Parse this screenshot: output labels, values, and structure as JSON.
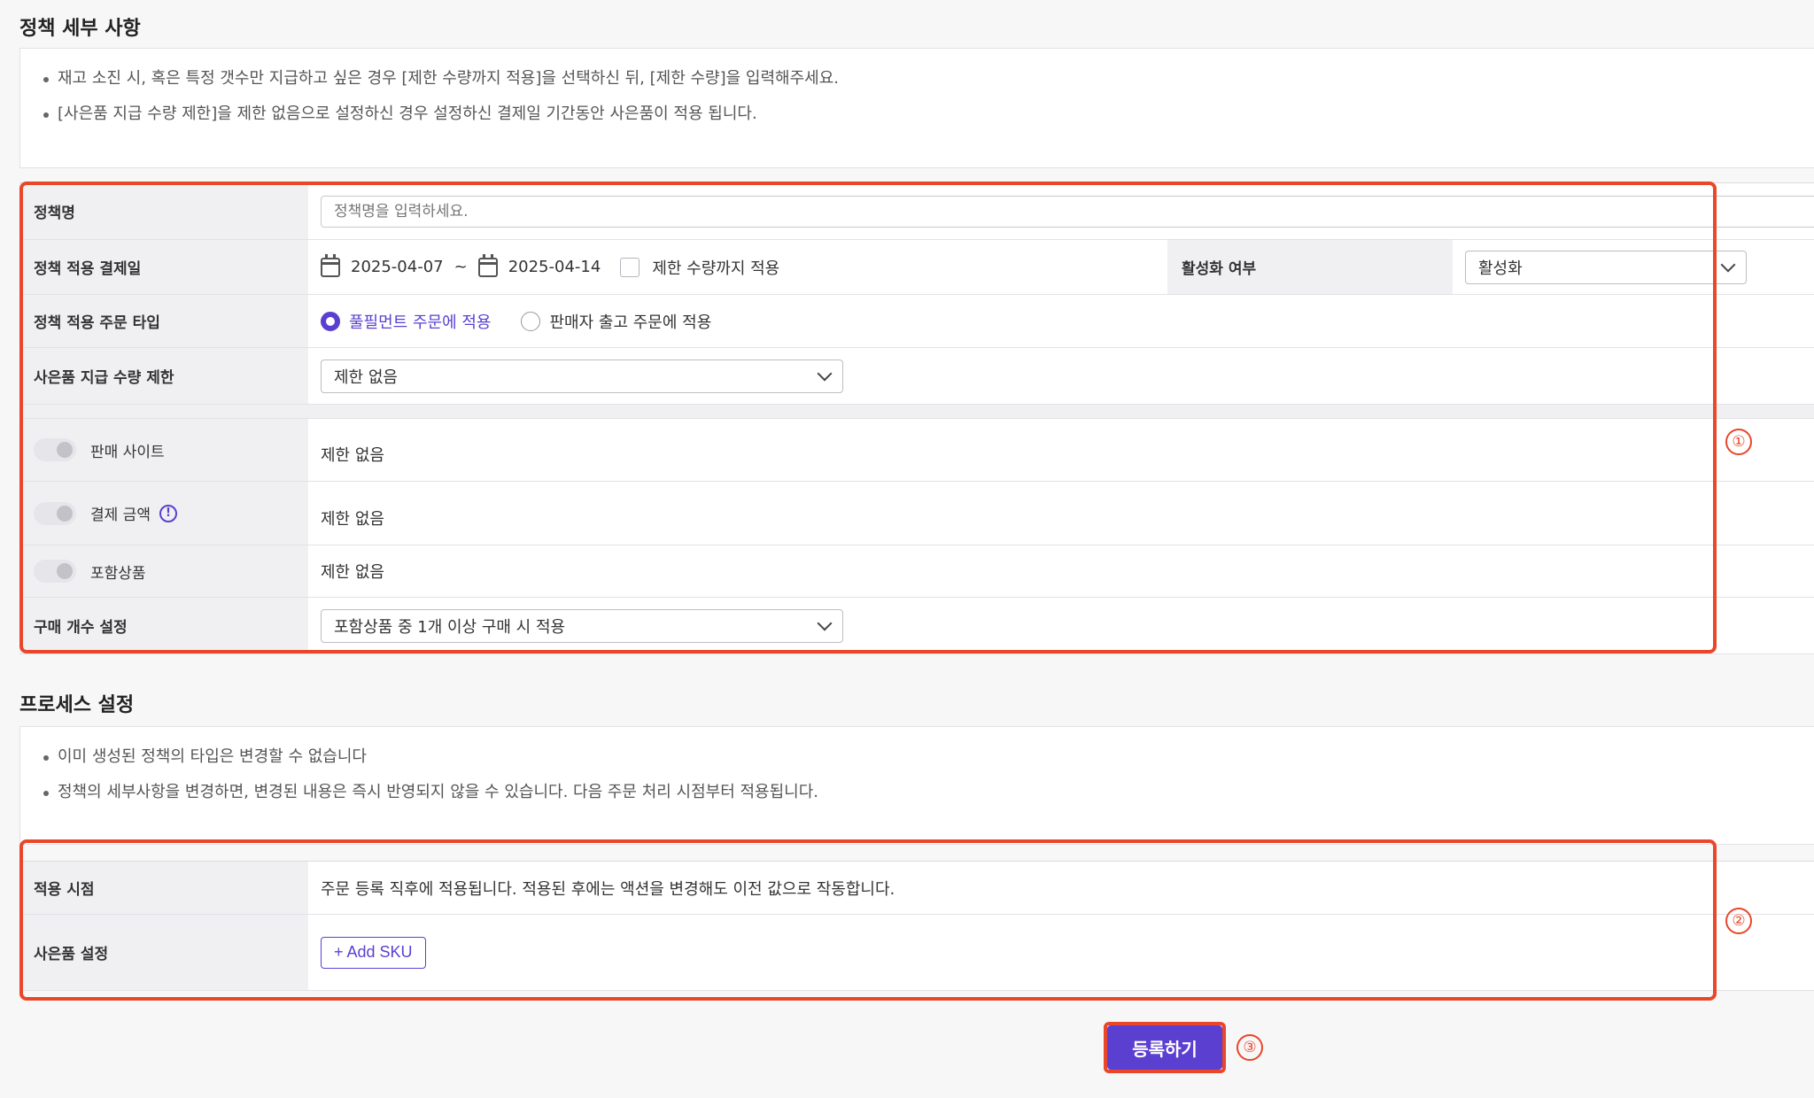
{
  "policy": {
    "section_title": "정책 세부 사항",
    "notices": [
      "재고 소진 시, 혹은 특정 갯수만 지급하고 싶은 경우 [제한 수량까지 적용]을 선택하신 뒤, [제한 수량]을 입력해주세요.",
      "[사은품 지급 수량 제한]을 제한 없음으로 설정하신 경우 설정하신 결제일 기간동안 사은품이 적용 됩니다."
    ],
    "name_label": "정책명",
    "name_placeholder": "정책명을 입력하세요.",
    "date_label": "정책 적용 결제일",
    "date_start": "2025-04-07",
    "date_sep": "~",
    "date_end": "2025-04-14",
    "limit_checkbox_label": "제한 수량까지 적용",
    "active_label": "활성화 여부",
    "active_value": "활성화",
    "order_type_label": "정책 적용 주문 타입",
    "order_type_option1": "풀필먼트 주문에 적용",
    "order_type_option2": "판매자 출고 주문에 적용",
    "gift_limit_label": "사은품 지급 수량 제한",
    "gift_limit_value": "제한 없음",
    "site_label": "판매 사이트",
    "site_value": "제한 없음",
    "amount_label": "결제 금액",
    "amount_value": "제한 없음",
    "product_label": "포함상품",
    "product_value": "제한 없음",
    "qty_label": "구매 개수 설정",
    "qty_value": "포함상품 중 1개 이상 구매 시 적용"
  },
  "process": {
    "section_title": "프로세스 설정",
    "notices": [
      "이미 생성된 정책의 타입은 변경할 수 없습니다",
      "정책의 세부사항을 변경하면, 변경된 내용은 즉시 반영되지 않을 수 있습니다. 다음 주문 처리 시점부터 적용됩니다."
    ],
    "timing_label": "적용 시점",
    "timing_value": "주문 등록 직후에 적용됩니다. 적용된 후에는 액션을 변경해도 이전 값으로 작동합니다.",
    "gift_label": "사은품 설정",
    "add_sku": "+ Add SKU"
  },
  "submit_label": "등록하기",
  "markers": [
    "①",
    "②",
    "③"
  ],
  "colors": {
    "accent": "#5b3fd1",
    "highlight": "#e8472a"
  }
}
